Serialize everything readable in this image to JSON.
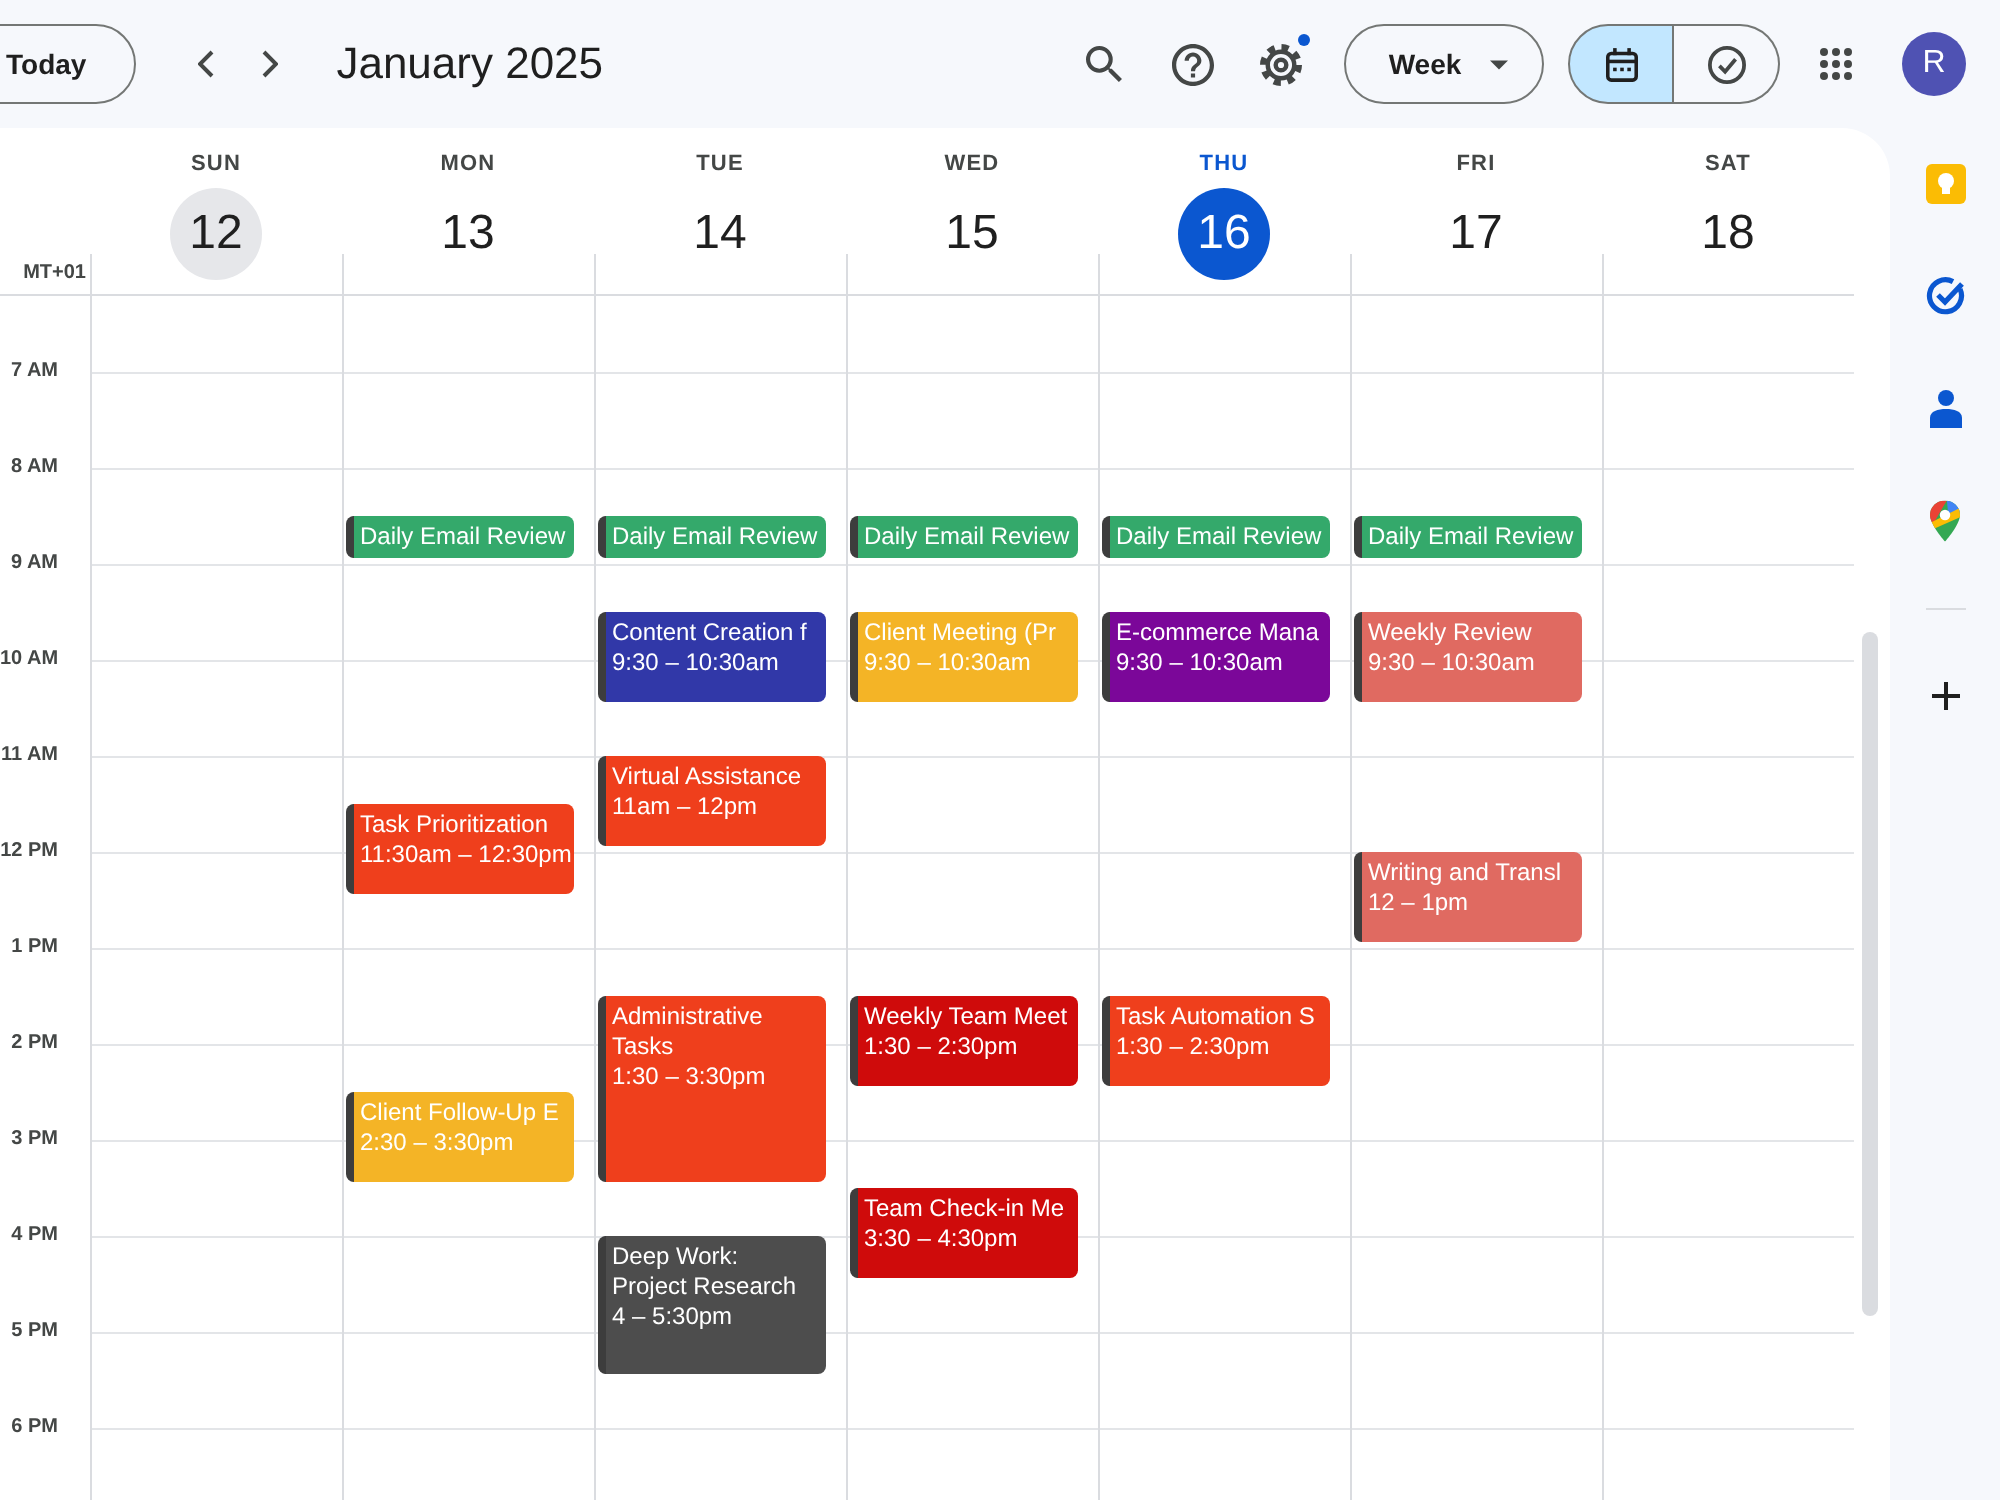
{
  "toolbar": {
    "today_button": "Today",
    "title": "January 2025",
    "settings_badge": true,
    "view_dropdown": "Week",
    "view_toggle": [
      {
        "kind": "calendar",
        "selected": true
      },
      {
        "kind": "tasks",
        "selected": false
      }
    ],
    "account_initial": "R"
  },
  "week": {
    "timezone": "MT+01",
    "hours": [
      "7 AM",
      "8 AM",
      "9 AM",
      "10 AM",
      "11 AM",
      "12 PM",
      "1 PM",
      "2 PM",
      "3 PM",
      "4 PM",
      "5 PM",
      "6 PM"
    ],
    "days": [
      {
        "weekday": "SUN",
        "date": "12",
        "today": false,
        "hovered": true
      },
      {
        "weekday": "MON",
        "date": "13",
        "today": false,
        "hovered": false,
        "events": [
          {
            "title": "Daily Email Review",
            "color": "#34a96b"
          },
          {
            "title": "Task Prioritization",
            "time": "11:30am – 12:30pm",
            "color": "#ef3f1c"
          },
          {
            "title": "Client Follow-Up E",
            "time": "2:30 – 3:30pm",
            "color": "#f4b426"
          }
        ]
      },
      {
        "weekday": "TUE",
        "date": "14",
        "today": false,
        "hovered": false,
        "events": [
          {
            "title": "Daily Email Review",
            "color": "#34a96b"
          },
          {
            "title": "Content Creation f",
            "time": "9:30 – 10:30am",
            "color": "#3138a8"
          },
          {
            "title": "Virtual Assistance",
            "time": "11am – 12pm",
            "color": "#ef3f1c"
          },
          {
            "title": "Administrative Tasks",
            "time": "1:30 – 3:30pm",
            "color": "#ef3f1c"
          },
          {
            "title": "Deep Work: Project Research",
            "time": "4 – 5:30pm",
            "color": "#4d4d4d"
          }
        ]
      },
      {
        "weekday": "WED",
        "date": "15",
        "today": false,
        "hovered": false,
        "events": [
          {
            "title": "Daily Email Review",
            "color": "#34a96b"
          },
          {
            "title": "Client Meeting (Pr",
            "time": "9:30 – 10:30am",
            "color": "#f4b426"
          },
          {
            "title": "Weekly Team Meet",
            "time": "1:30 – 2:30pm",
            "color": "#cf0b0b"
          },
          {
            "title": "Team Check-in Me",
            "time": "3:30 – 4:30pm",
            "color": "#cf0b0b"
          }
        ]
      },
      {
        "weekday": "THU",
        "date": "16",
        "today": true,
        "hovered": false,
        "events": [
          {
            "title": "Daily Email Review",
            "color": "#34a96b"
          },
          {
            "title": "E-commerce Mana",
            "time": "9:30 – 10:30am",
            "color": "#7b0799"
          },
          {
            "title": "Task Automation S",
            "time": "1:30 – 2:30pm",
            "color": "#ef3f1c"
          }
        ]
      },
      {
        "weekday": "FRI",
        "date": "17",
        "today": false,
        "hovered": false,
        "events": [
          {
            "title": "Daily Email Review",
            "color": "#34a96b"
          },
          {
            "title": "Weekly Review",
            "time": "9:30 – 10:30am",
            "color": "#e06a61"
          },
          {
            "title": "Writing and Transl",
            "time": "12 – 1pm",
            "color": "#e06a61"
          }
        ]
      },
      {
        "weekday": "SAT",
        "date": "18",
        "today": false,
        "hovered": false
      }
    ]
  },
  "side_panel": {
    "apps": [
      {
        "kind": "notes"
      },
      {
        "kind": "tasks"
      },
      {
        "kind": "contacts"
      },
      {
        "kind": "maps"
      }
    ]
  }
}
